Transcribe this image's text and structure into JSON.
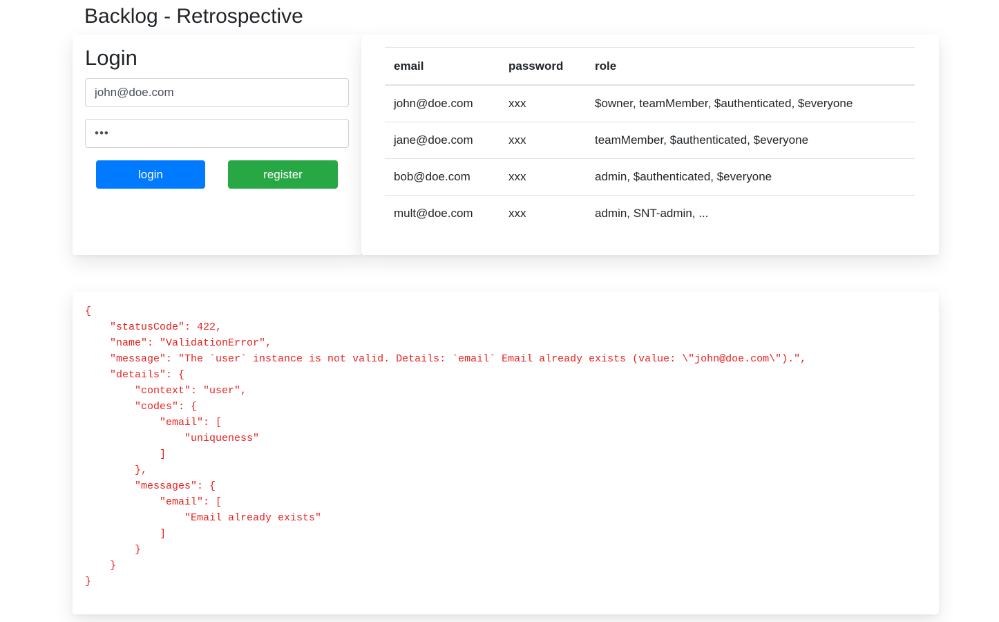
{
  "app": {
    "title": "Backlog - Retrospective"
  },
  "login": {
    "heading": "Login",
    "email_value": "john@doe.com",
    "password_value": "xxx",
    "login_label": "login",
    "register_label": "register"
  },
  "users_table": {
    "headers": [
      "email",
      "password",
      "role"
    ],
    "rows": [
      [
        "john@doe.com",
        "xxx",
        "$owner, teamMember, $authenticated, $everyone"
      ],
      [
        "jane@doe.com",
        "xxx",
        "teamMember, $authenticated, $everyone"
      ],
      [
        "bob@doe.com",
        "xxx",
        "admin, $authenticated, $everyone"
      ],
      [
        "mult@doe.com",
        "xxx",
        "admin, SNT-admin, ..."
      ]
    ]
  },
  "error_response": {
    "text": "{\n    \"statusCode\": 422,\n    \"name\": \"ValidationError\",\n    \"message\": \"The `user` instance is not valid. Details: `email` Email already exists (value: \\\"john@doe.com\\\").\",\n    \"details\": {\n        \"context\": \"user\",\n        \"codes\": {\n            \"email\": [\n                \"uniqueness\"\n            ]\n        },\n        \"messages\": {\n            \"email\": [\n                \"Email already exists\"\n            ]\n        }\n    }\n}"
  },
  "colors": {
    "primary": "#007bff",
    "success": "#28a745",
    "error_text": "#e8201f"
  }
}
